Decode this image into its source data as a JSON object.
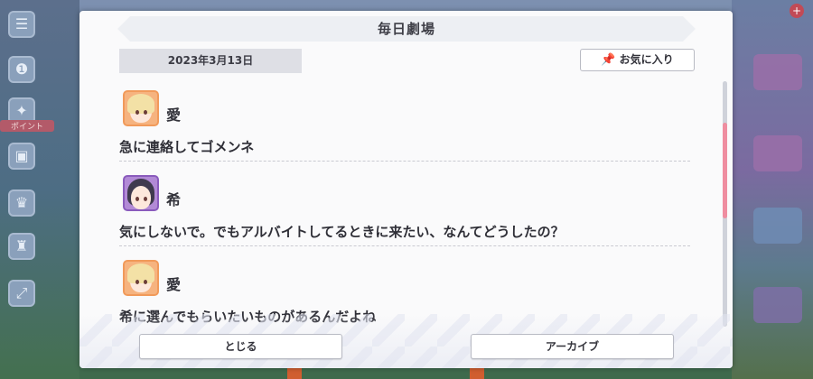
{
  "background": {
    "left_menu": [
      {
        "icon": "menu-icon"
      },
      {
        "icon": "chat-icon"
      },
      {
        "icon": "gift-icon",
        "tag": "ポイント"
      },
      {
        "icon": "trophy-icon"
      },
      {
        "icon": "present-icon"
      },
      {
        "icon": "expand-icon"
      }
    ]
  },
  "dialog": {
    "title": "毎日劇場",
    "date": "2023年3月13日",
    "favorite_label": "お気に入り",
    "entries": [
      {
        "speaker": "愛",
        "text": "急に連絡してゴメンネ",
        "avatar": "ai"
      },
      {
        "speaker": "希",
        "text": "気にしないで。でもアルバイトしてるときに来たい、なんてどうしたの？",
        "avatar": "nozomi"
      },
      {
        "speaker": "愛",
        "text": "希に選んでもらいたいものがあるんだよね",
        "avatar": "ai"
      }
    ],
    "close_label": "とじる",
    "archive_label": "アーカイブ"
  },
  "colors": {
    "scroll_thumb": "#ef8da0",
    "ai_avatar_frame": "#f19a5a",
    "nozomi_avatar_frame": "#8a5bbd"
  }
}
